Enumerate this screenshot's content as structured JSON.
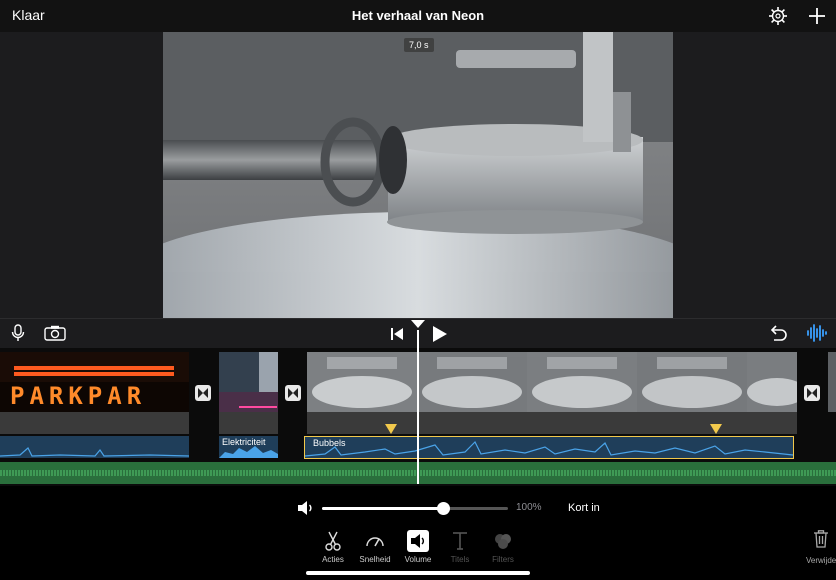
{
  "topbar": {
    "done_label": "Klaar",
    "title": "Het verhaal van Neon"
  },
  "preview": {
    "duration_badge": "7,0 s"
  },
  "timeline": {
    "clips": [
      {
        "name": "park-sign-clip",
        "sign_text": "PARKPAR"
      },
      {
        "name": "elektriciteit-clip",
        "audio_label": "Elektriciteit"
      },
      {
        "name": "bubbels-clip",
        "audio_label": "Bubbels"
      }
    ]
  },
  "volume": {
    "level_fraction": 0.65,
    "percent_label": "100%",
    "fade_label": "Kort in"
  },
  "tools": [
    {
      "id": "acties",
      "label": "Acties",
      "icon": "scissors-icon",
      "enabled": true
    },
    {
      "id": "snelheid",
      "label": "Snelheid",
      "icon": "speedometer-icon",
      "enabled": true
    },
    {
      "id": "volume",
      "label": "Volume",
      "icon": "speaker-icon",
      "enabled": true,
      "selected": true
    },
    {
      "id": "titels",
      "label": "Titels",
      "icon": "title-t-icon",
      "enabled": false
    },
    {
      "id": "filters",
      "label": "Filters",
      "icon": "filters-icon",
      "enabled": false
    }
  ],
  "delete_label": "Verwijder",
  "colors": {
    "audio_waveform": "#4aa3e8",
    "bubbels_border": "#f2c94c",
    "music_track": "#2a6f3c",
    "sign_orange": "#ff8a2a"
  }
}
